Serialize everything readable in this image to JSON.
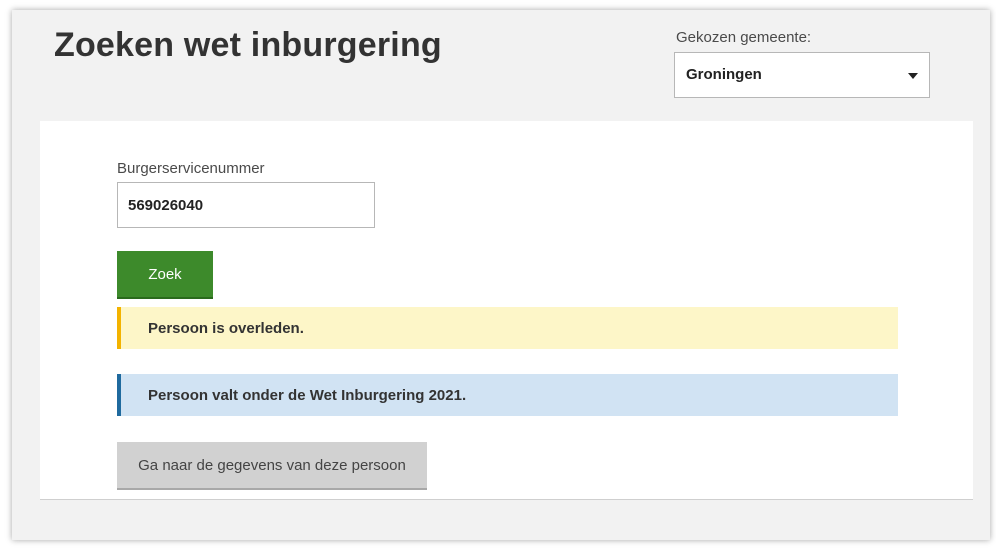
{
  "header": {
    "title": "Zoeken wet inburgering",
    "municipality_label": "Gekozen gemeente:",
    "municipality_value": "Groningen"
  },
  "form": {
    "bsn_label": "Burgerservicenummer",
    "bsn_value": "569026040",
    "search_label": "Zoek"
  },
  "alerts": [
    {
      "type": "warning",
      "text": "Persoon is overleden."
    },
    {
      "type": "info",
      "text": "Persoon valt onder de Wet Inburgering 2021."
    }
  ],
  "actions": {
    "details_label": "Ga naar de gegevens van deze persoon"
  },
  "colors": {
    "primary_button": "#3d8a2b",
    "warning_background": "#fdf6c8",
    "warning_accent": "#f3b300",
    "info_background": "#d1e3f3",
    "info_accent": "#1f6a9e",
    "secondary_button": "#d1d1d1"
  },
  "icons": {
    "select_caret": "caret-down-icon"
  }
}
